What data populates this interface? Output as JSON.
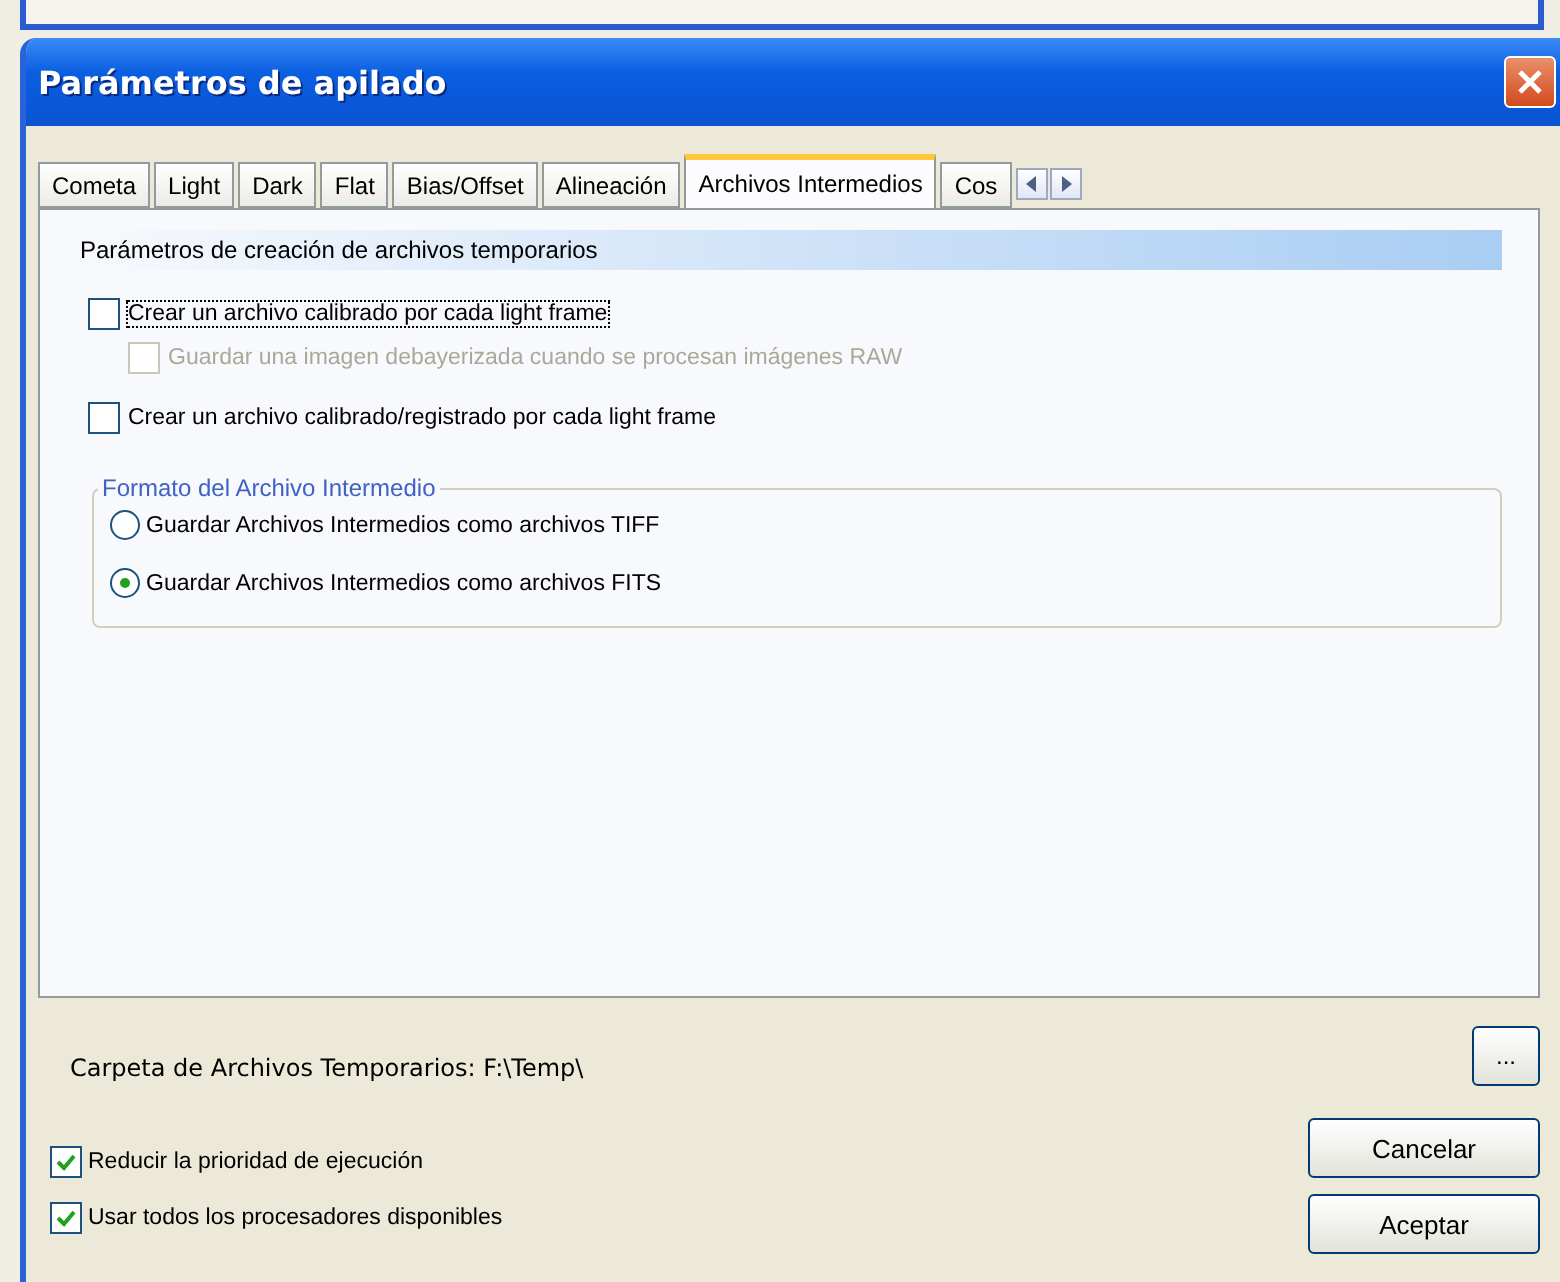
{
  "window": {
    "title": "Parámetros de apilado"
  },
  "tabs": [
    {
      "label": "Cometa",
      "selected": false
    },
    {
      "label": "Light",
      "selected": false
    },
    {
      "label": "Dark",
      "selected": false
    },
    {
      "label": "Flat",
      "selected": false
    },
    {
      "label": "Bias/Offset",
      "selected": false
    },
    {
      "label": "Alineación",
      "selected": false
    },
    {
      "label": "Archivos Intermedios",
      "selected": true
    },
    {
      "label": "Cos",
      "selected": false
    }
  ],
  "section_title": "Parámetros de creación de archivos temporarios",
  "options": [
    {
      "label": "Crear un archivo calibrado por cada light frame",
      "checked": false,
      "disabled": false,
      "focused": true,
      "children": [
        {
          "label": "Guardar una imagen debayerizada cuando se procesan imágenes RAW",
          "checked": false,
          "disabled": true,
          "focused": false
        }
      ]
    },
    {
      "label": "Crear un archivo calibrado/registrado por cada light frame",
      "checked": false,
      "disabled": false,
      "focused": false
    }
  ],
  "format_group": {
    "title": "Formato del Archivo Intermedio",
    "options": [
      {
        "label": "Guardar Archivos Intermedios como archivos TIFF",
        "selected": false
      },
      {
        "label": "Guardar Archivos Intermedios como archivos FITS",
        "selected": true
      }
    ]
  },
  "temp_folder": {
    "label": "Carpeta de Archivos Temporarios:",
    "value": "F:\\Temp\\",
    "browse": "..."
  },
  "bottom_options": [
    {
      "label": "Reducir la prioridad de ejecución",
      "checked": true
    },
    {
      "label": "Usar todos los procesadores disponibles",
      "checked": true
    }
  ],
  "buttons": [
    "Cancelar",
    "Aceptar"
  ]
}
